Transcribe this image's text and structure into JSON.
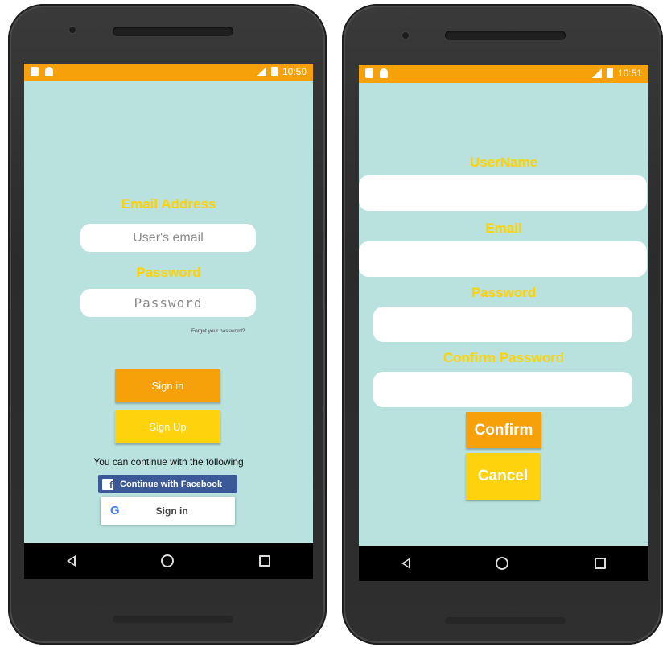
{
  "left_screen": {
    "status_time": "10:50",
    "email_label": "Email Address",
    "email_placeholder": "User's email",
    "password_label": "Password",
    "password_placeholder": "Password",
    "forgot_link": "Forget your password?",
    "sign_in_button": "Sign in",
    "sign_up_button": "Sign Up",
    "continue_text": "You can continue with the following",
    "facebook_button": "Continue with Facebook",
    "facebook_icon_glyph": "f",
    "google_button": "Sign in",
    "google_icon_glyph": "G"
  },
  "right_screen": {
    "status_time": "10:51",
    "username_label": "UserName",
    "email_label": "Email",
    "password_label": "Password",
    "confirm_password_label": "Confirm Password",
    "confirm_button": "Confirm",
    "cancel_button": "Cancel"
  },
  "colors": {
    "screen_bg": "#b9e2de",
    "status_bar": "#f7a10a",
    "label_yellow": "#ffd200",
    "sign_in_orange": "#f7a10a",
    "sign_up_yellow": "#fed20c",
    "facebook_blue": "#3b5998"
  }
}
